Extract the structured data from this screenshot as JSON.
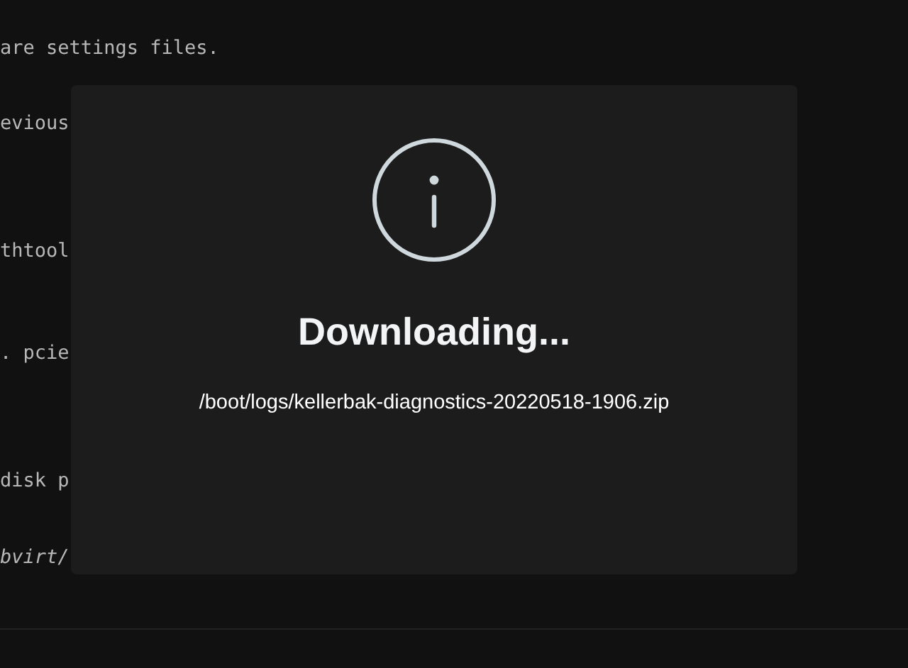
{
  "background_lines": [
    {
      "text": "are settings files.",
      "italic": false
    },
    {
      "text": "evious",
      "italic": false
    },
    {
      "text": "thtool",
      "italic": false
    },
    {
      "text": ". pcie",
      "italic": false
    },
    {
      "text": "disk p",
      "italic": false
    },
    {
      "text": "bvirt/",
      "italic": true
    }
  ],
  "dialog": {
    "title": "Downloading...",
    "message": "/boot/logs/kellerbak-diagnostics-20220518-1906.zip"
  }
}
